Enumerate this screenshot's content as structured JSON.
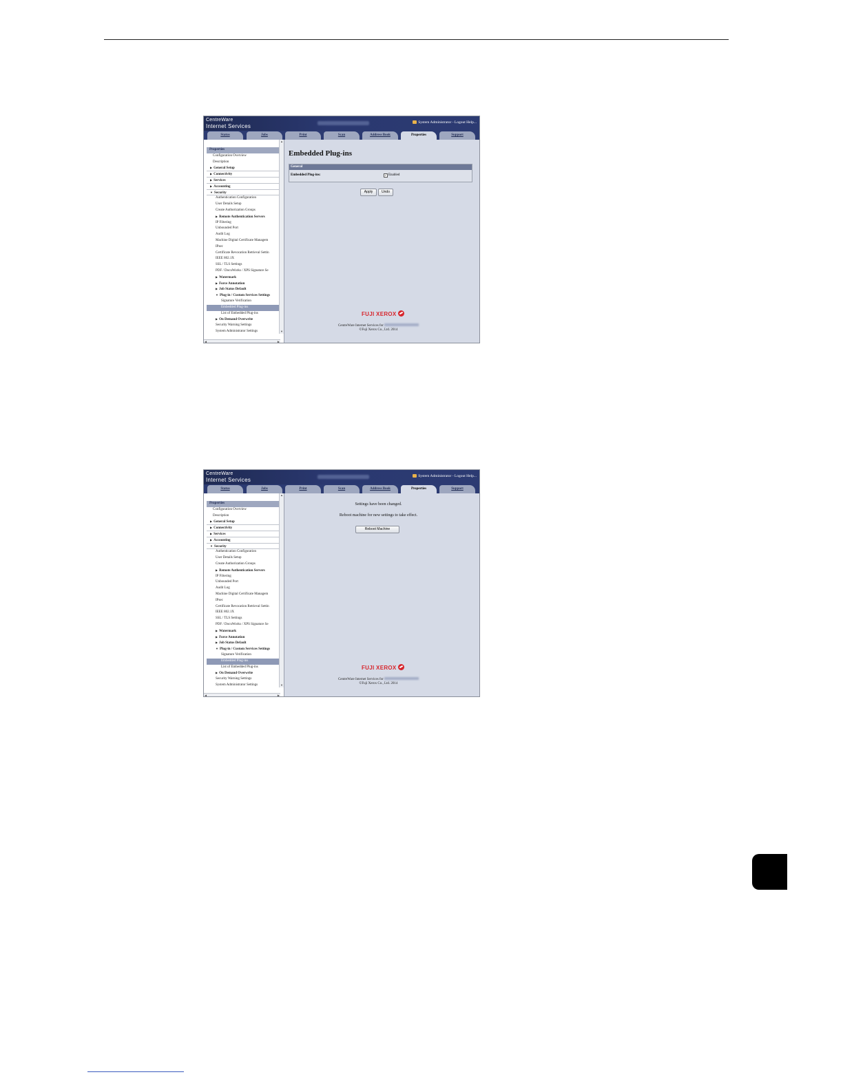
{
  "screen": {
    "brand_line1": "CentreWare",
    "brand_line2": "Internet Services",
    "user_text": "System Administrator - Logout Help...",
    "tabs": [
      "Status",
      "Jobs",
      "Print",
      "Scan",
      "Address Book",
      "Properties",
      "Support"
    ],
    "active_tab": "Properties",
    "nav": [
      {
        "label": "Properties",
        "level": "hdrow"
      },
      {
        "label": "Configuration Overview",
        "level": "l0"
      },
      {
        "label": "Description",
        "level": "l0"
      },
      {
        "label": "General Setup",
        "level": "l0b",
        "arrow": "▶"
      },
      {
        "label": "Connectivity",
        "level": "l0b",
        "arrow": "▶"
      },
      {
        "label": "Services",
        "level": "l0b",
        "arrow": "▶"
      },
      {
        "label": "Accounting",
        "level": "l0b",
        "arrow": "▶"
      },
      {
        "label": "Security",
        "level": "l0b",
        "arrow": "▼"
      },
      {
        "label": "Authentication Configuration",
        "level": "l1"
      },
      {
        "label": "User Details Setup",
        "level": "l1"
      },
      {
        "label": "Create Authorization Groups",
        "level": "l1"
      },
      {
        "label": "Remote Authentication Servers",
        "level": "l1b",
        "arrow": "▶"
      },
      {
        "label": "IP Filtering",
        "level": "l1"
      },
      {
        "label": "Unbounded Port",
        "level": "l1"
      },
      {
        "label": "Audit Log",
        "level": "l1"
      },
      {
        "label": "Machine Digital Certificate Managem",
        "level": "l1"
      },
      {
        "label": "IPsec",
        "level": "l1"
      },
      {
        "label": "Certificate Revocation Retrieval Settin",
        "level": "l1"
      },
      {
        "label": "IEEE 802.1X",
        "level": "l1"
      },
      {
        "label": "SSL / TLS Settings",
        "level": "l1"
      },
      {
        "label": "PDF / DocuWorks / XPS Signature Se",
        "level": "l1"
      },
      {
        "label": "Watermark",
        "level": "l1b",
        "arrow": "▶"
      },
      {
        "label": "Force Annotation",
        "level": "l1b",
        "arrow": "▶"
      },
      {
        "label": "Job Status Default",
        "level": "l1b",
        "arrow": "▶"
      },
      {
        "label": "Plug-in / Custom Services Settings",
        "level": "l1b",
        "arrow": "▼"
      },
      {
        "label": "Signature Verification",
        "level": "l2"
      },
      {
        "label": "Embedded Plug-ins",
        "level": "l2",
        "selected": true
      },
      {
        "label": "List of Embedded Plug-ins",
        "level": "l2"
      },
      {
        "label": "On Demand Overwrite",
        "level": "l1b",
        "arrow": "▶"
      },
      {
        "label": "Security Warning Settings",
        "level": "l1"
      },
      {
        "label": "System Administrator Settings",
        "level": "l1"
      }
    ],
    "footer_line1": "CentreWare Internet Services for",
    "footer_line2": "©Fuji Xerox Co., Ltd. 2014",
    "logo_text": "FUJI XEROX"
  },
  "shot1": {
    "page_title": "Embedded Plug-ins",
    "panel_header": "General",
    "row_label": "Embedded Plug-ins:",
    "check_label": "Enabled",
    "checked": true,
    "apply_label": "Apply",
    "undo_label": "Undo"
  },
  "shot2": {
    "message1": "Settings have been changed.",
    "message2": "Reboot machine for new settings to take effect.",
    "reboot_label": "Reboot Machine"
  }
}
